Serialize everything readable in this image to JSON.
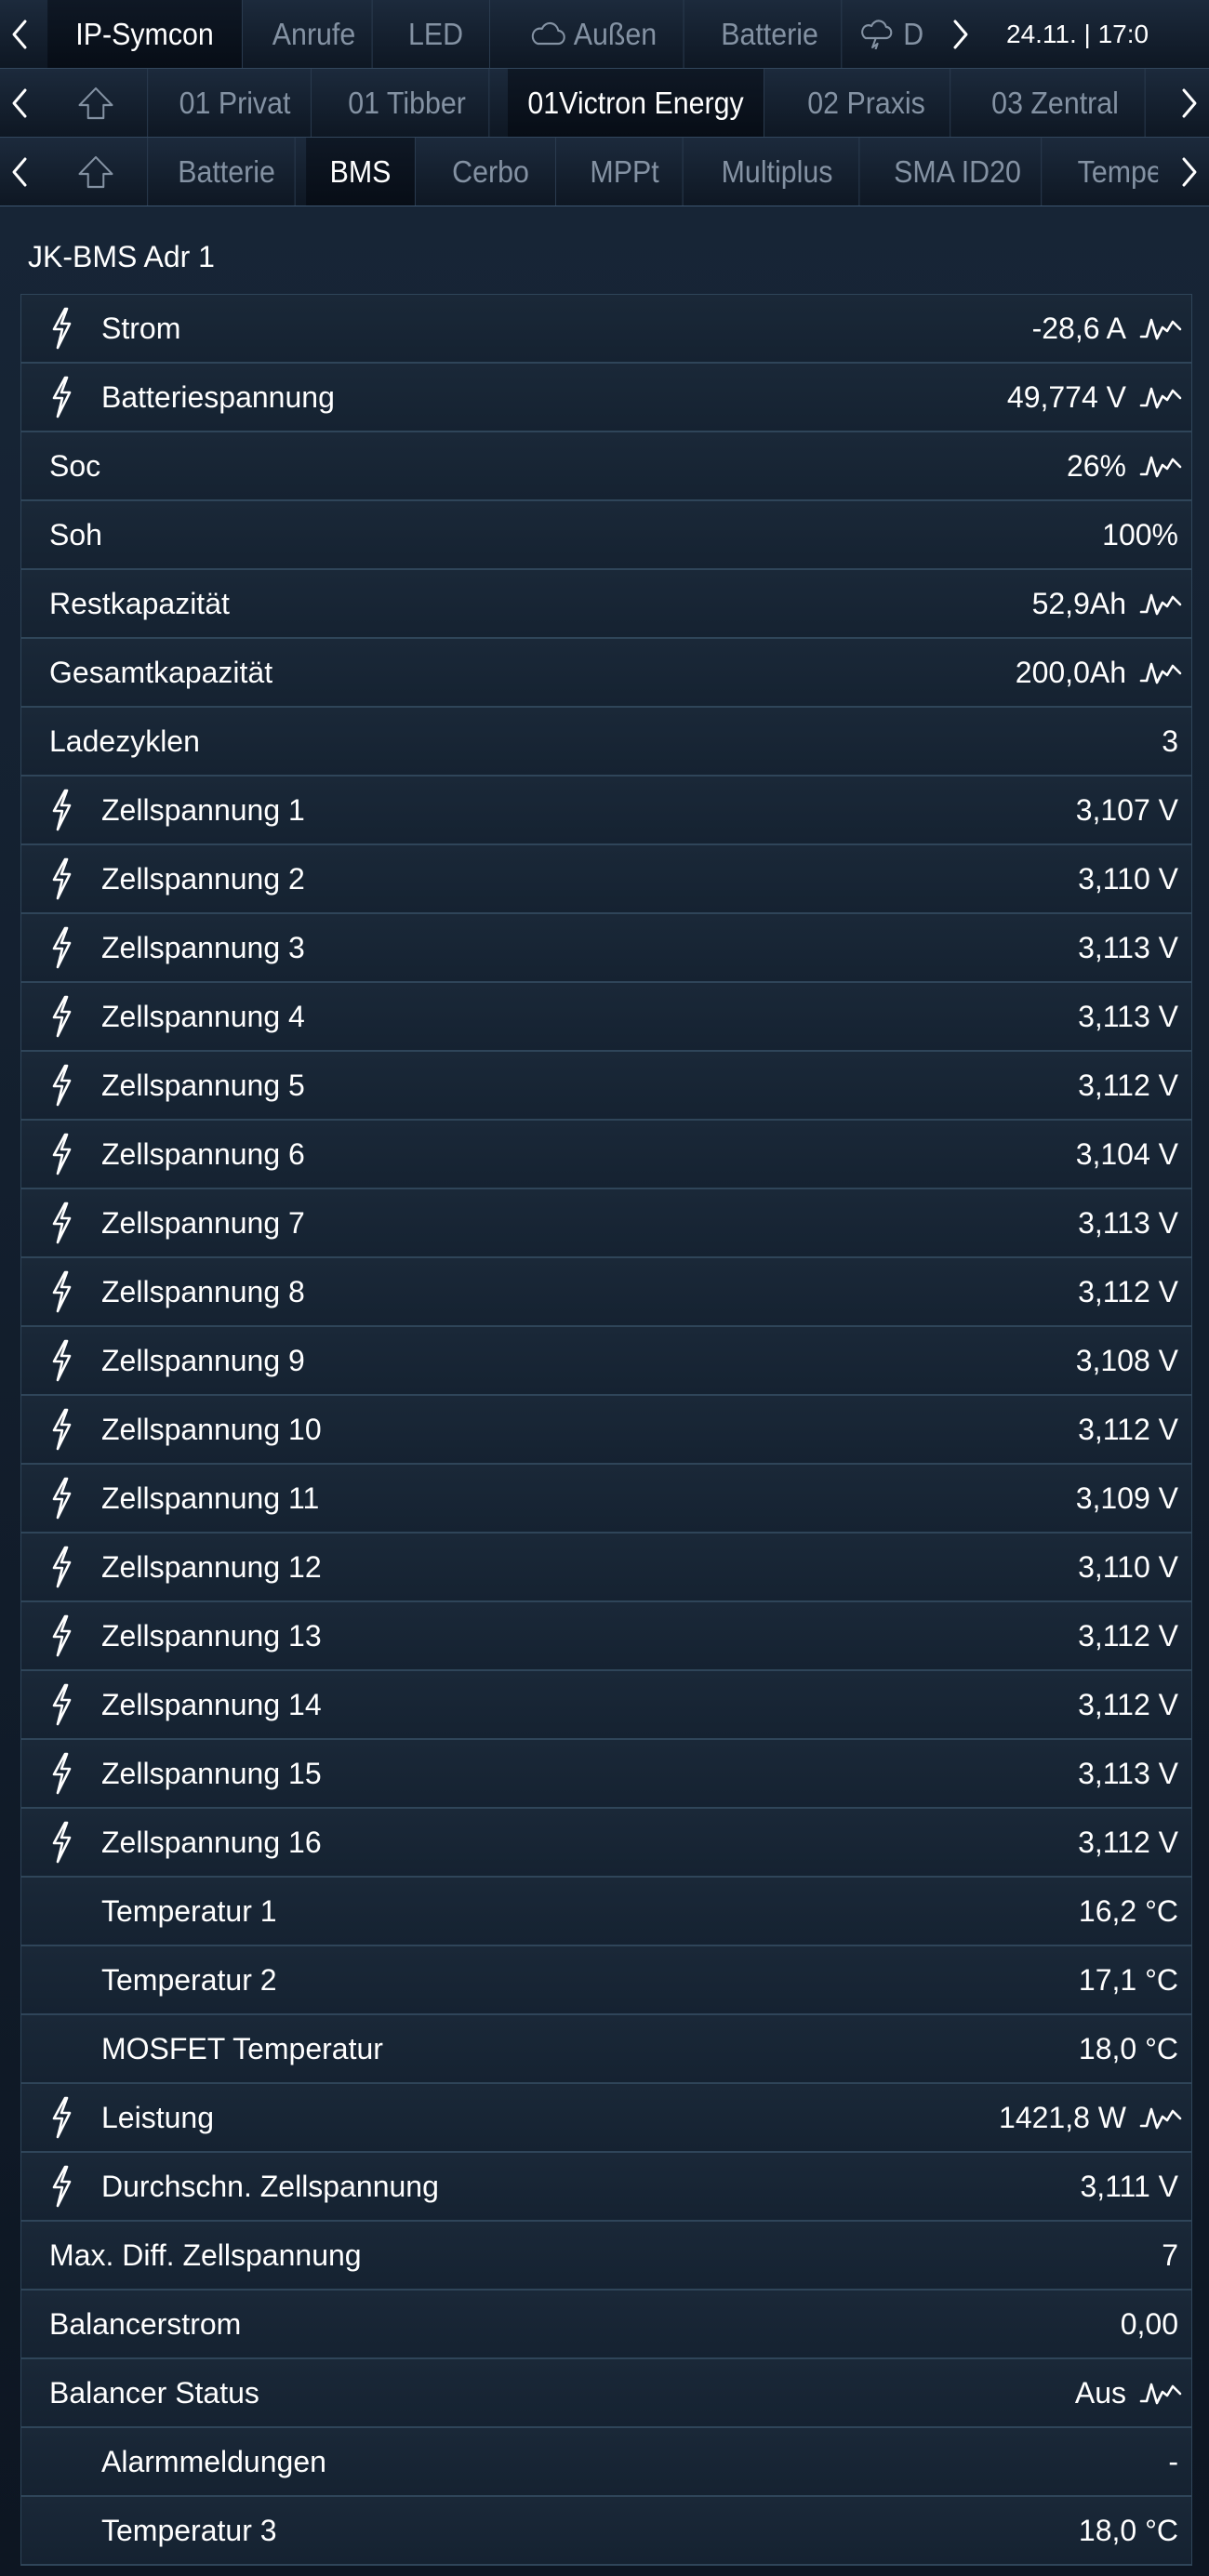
{
  "nav_top": {
    "items": [
      {
        "label": "IP-Symcon",
        "active": true
      },
      {
        "label": "Anrufe"
      },
      {
        "label": "LED"
      },
      {
        "label": "Außen",
        "icon": "cloud-icon"
      },
      {
        "label": "Batterie"
      },
      {
        "label": "D",
        "icon": "storm-cloud-icon"
      }
    ],
    "clock": "24.11. | 17:0"
  },
  "nav_rooms": {
    "items": [
      {
        "label": "01 Privat"
      },
      {
        "label": "01 Tibber"
      },
      {
        "label": "01Victron Energy",
        "active": true
      },
      {
        "label": "02 Praxis"
      },
      {
        "label": "03 Zentral"
      }
    ]
  },
  "nav_sub": {
    "items": [
      {
        "label": "Batterie"
      },
      {
        "label": "BMS",
        "active": true
      },
      {
        "label": "Cerbo"
      },
      {
        "label": "MPPt"
      },
      {
        "label": "Multiplus"
      },
      {
        "label": "SMA ID20"
      },
      {
        "label": "Tempe"
      }
    ]
  },
  "section": {
    "title": "JK-BMS Adr 1"
  },
  "rows": [
    {
      "label": "Strom",
      "value": "-28,6 A",
      "icon": "bolt-icon",
      "chart": true
    },
    {
      "label": "Batteriespannung",
      "value": "49,774 V",
      "icon": "bolt-icon",
      "chart": true
    },
    {
      "label": "Soc",
      "value": "26%",
      "chart": true
    },
    {
      "label": "Soh",
      "value": "100%"
    },
    {
      "label": "Restkapazität",
      "value": "52,9Ah",
      "chart": true
    },
    {
      "label": "Gesamtkapazität",
      "value": "200,0Ah",
      "chart": true
    },
    {
      "label": "Ladezyklen",
      "value": "3"
    },
    {
      "label": "Zellspannung 1",
      "value": "3,107 V",
      "icon": "bolt-icon"
    },
    {
      "label": "Zellspannung 2",
      "value": "3,110 V",
      "icon": "bolt-icon"
    },
    {
      "label": "Zellspannung 3",
      "value": "3,113 V",
      "icon": "bolt-icon"
    },
    {
      "label": "Zellspannung 4",
      "value": "3,113 V",
      "icon": "bolt-icon"
    },
    {
      "label": "Zellspannung 5",
      "value": "3,112 V",
      "icon": "bolt-icon"
    },
    {
      "label": "Zellspannung 6",
      "value": "3,104 V",
      "icon": "bolt-icon"
    },
    {
      "label": "Zellspannung 7",
      "value": "3,113 V",
      "icon": "bolt-icon"
    },
    {
      "label": "Zellspannung 8",
      "value": "3,112 V",
      "icon": "bolt-icon"
    },
    {
      "label": "Zellspannung 9",
      "value": "3,108 V",
      "icon": "bolt-icon"
    },
    {
      "label": "Zellspannung 10",
      "value": "3,112 V",
      "icon": "bolt-icon"
    },
    {
      "label": "Zellspannung 11",
      "value": "3,109 V",
      "icon": "bolt-icon"
    },
    {
      "label": "Zellspannung 12",
      "value": "3,110 V",
      "icon": "bolt-icon"
    },
    {
      "label": "Zellspannung 13",
      "value": "3,112 V",
      "icon": "bolt-icon"
    },
    {
      "label": "Zellspannung 14",
      "value": "3,112 V",
      "icon": "bolt-icon"
    },
    {
      "label": "Zellspannung 15",
      "value": "3,113 V",
      "icon": "bolt-icon"
    },
    {
      "label": "Zellspannung 16",
      "value": "3,112 V",
      "icon": "bolt-icon"
    },
    {
      "label": "Temperatur 1",
      "value": "16,2 °C",
      "indent": true
    },
    {
      "label": "Temperatur 2",
      "value": "17,1 °C",
      "indent": true
    },
    {
      "label": "MOSFET Temperatur",
      "value": "18,0 °C",
      "indent": true
    },
    {
      "label": "Leistung",
      "value": "1421,8 W",
      "icon": "bolt-icon",
      "chart": true
    },
    {
      "label": "Durchschn. Zellspannung",
      "value": "3,111 V",
      "icon": "bolt-icon"
    },
    {
      "label": "Max. Diff. Zellspannung",
      "value": "7"
    },
    {
      "label": "Balancerstrom",
      "value": "0,00"
    },
    {
      "label": "Balancer Status",
      "value": "Aus",
      "chart": true
    },
    {
      "label": "Alarmmeldungen",
      "value": "-",
      "indent": true
    },
    {
      "label": "Temperatur 3",
      "value": "18,0 °C",
      "indent": true
    }
  ]
}
